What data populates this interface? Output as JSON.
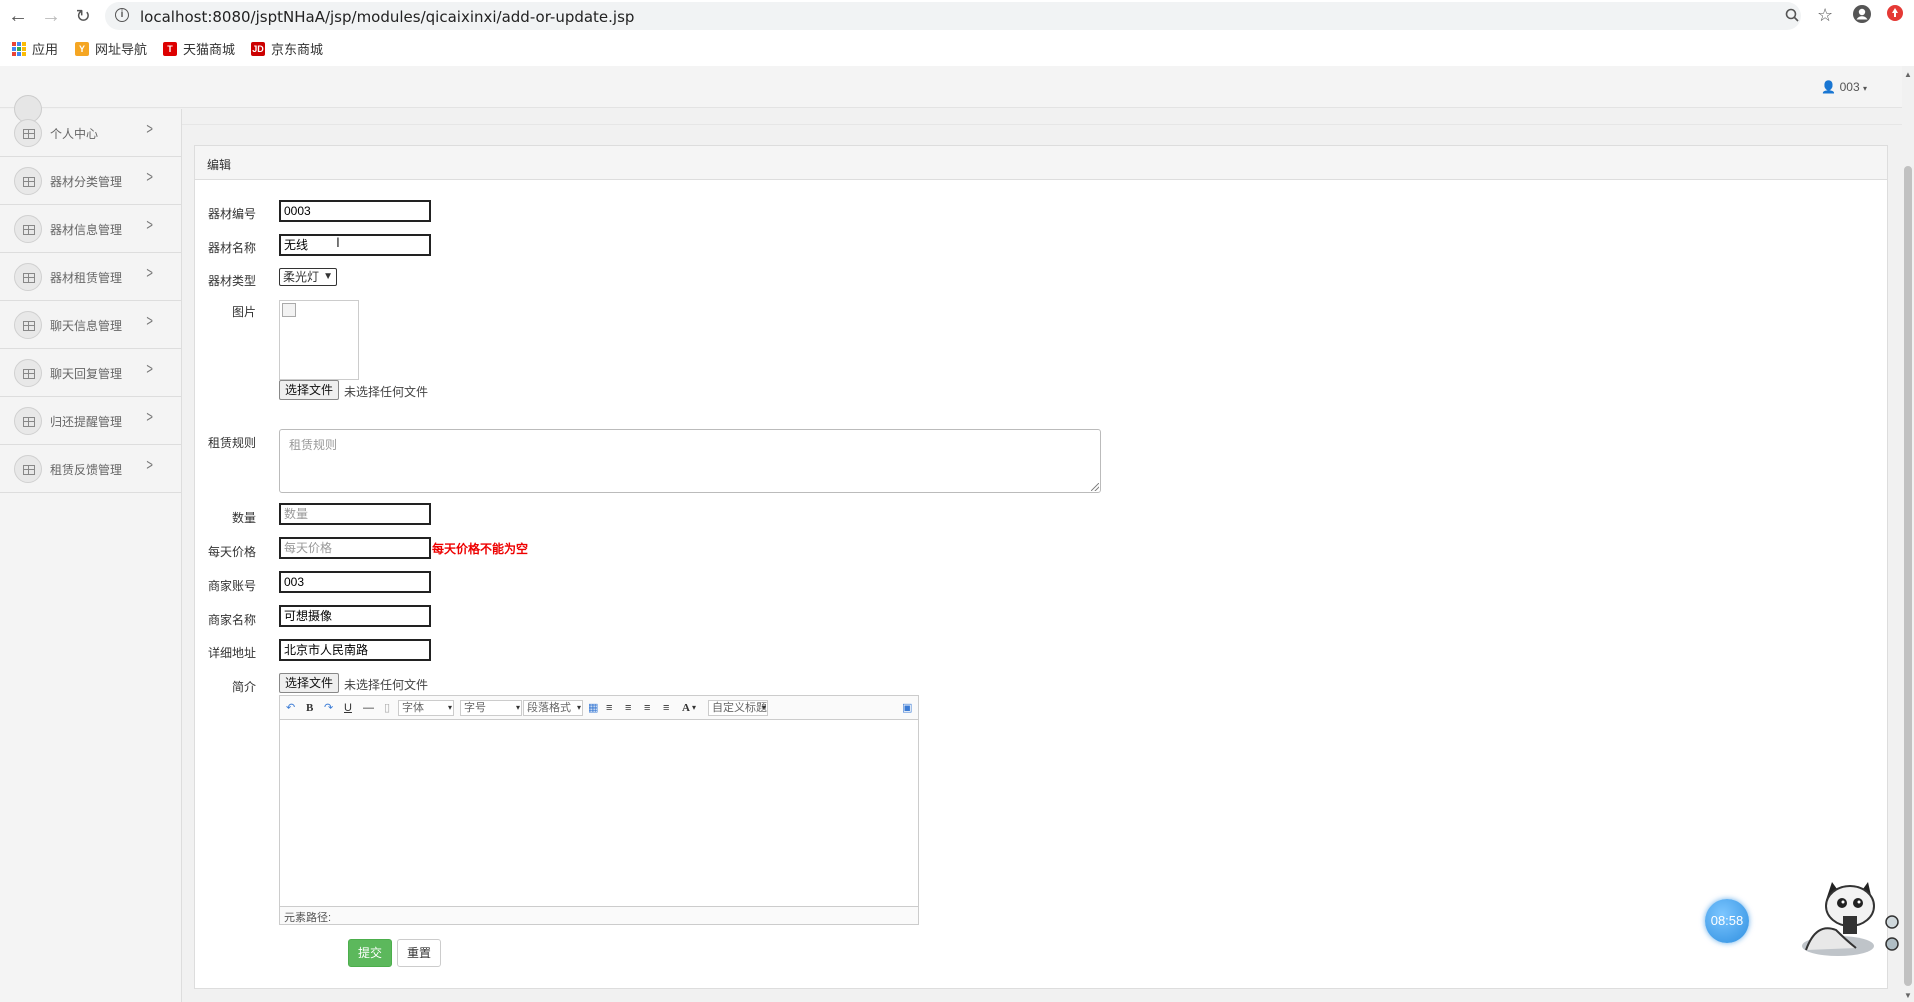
{
  "browser": {
    "url": "localhost:8080/jsptNHaA/jsp/modules/qicaixinxi/add-or-update.jsp",
    "bookmarks": [
      {
        "label": "应用"
      },
      {
        "label": "网址导航"
      },
      {
        "label": "天猫商城"
      },
      {
        "label": "京东商城"
      }
    ]
  },
  "header": {
    "user": "003"
  },
  "sidebar": {
    "items": [
      {
        "label": "个人中心"
      },
      {
        "label": "器材分类管理"
      },
      {
        "label": "器材信息管理"
      },
      {
        "label": "器材租赁管理"
      },
      {
        "label": "聊天信息管理"
      },
      {
        "label": "聊天回复管理"
      },
      {
        "label": "归还提醒管理"
      },
      {
        "label": "租赁反馈管理"
      }
    ]
  },
  "panel": {
    "title": "编辑"
  },
  "form": {
    "code": {
      "label": "器材编号",
      "value": "0003"
    },
    "name": {
      "label": "器材名称",
      "value": "无线"
    },
    "type": {
      "label": "器材类型",
      "value": "柔光灯"
    },
    "image": {
      "label": "图片",
      "file_button": "选择文件",
      "file_status": "未选择任何文件"
    },
    "rules": {
      "label": "租赁规则",
      "placeholder": "租赁规则"
    },
    "quantity": {
      "label": "数量",
      "placeholder": "数量"
    },
    "price": {
      "label": "每天价格",
      "placeholder": "每天价格",
      "error": "每天价格不能为空"
    },
    "merchant_account": {
      "label": "商家账号",
      "value": "003"
    },
    "merchant_name": {
      "label": "商家名称",
      "value": "可想摄像"
    },
    "address": {
      "label": "详细地址",
      "value": "北京市人民南路"
    },
    "intro": {
      "label": "简介",
      "file_button": "选择文件",
      "file_status": "未选择任何文件"
    }
  },
  "editor": {
    "font": "字体",
    "size": "字号",
    "paragraph": "段落格式",
    "custom": "自定义标题",
    "status": "元素路径:"
  },
  "buttons": {
    "submit": "提交",
    "reset": "重置"
  },
  "clock": {
    "time": "08:58"
  },
  "colors": {
    "submit": "#5cb85c",
    "error": "#ee0000"
  }
}
